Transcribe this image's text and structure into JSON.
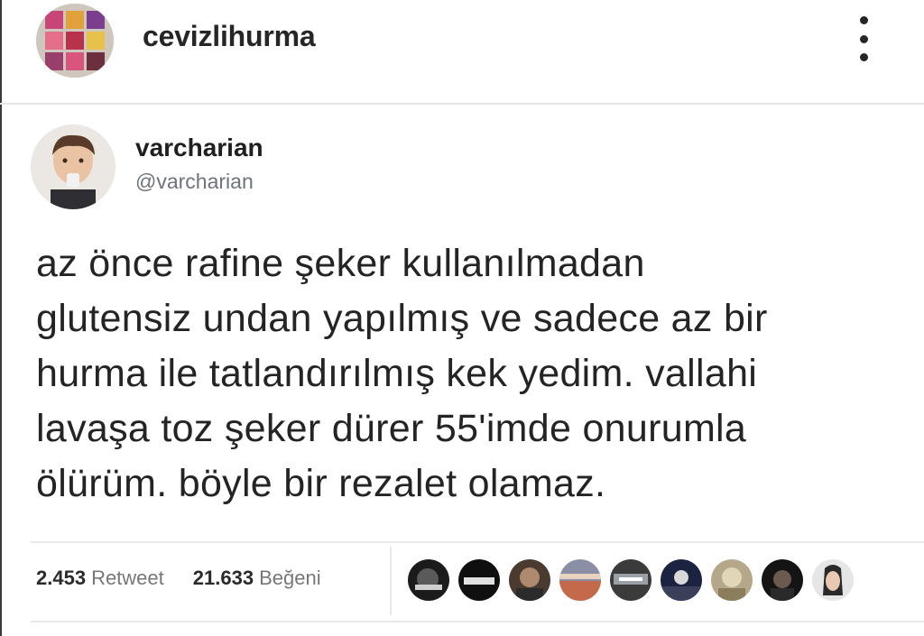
{
  "post": {
    "username": "cevizlihurma",
    "more_icon": "ellipsis-vertical-icon"
  },
  "tweet": {
    "display_name": "varcharian",
    "handle": "@varcharian",
    "text": "az önce rafine şeker kullanılmadan\nglutensiz undan yapılmış ve sadece az bir\nhurma ile tatlandırılmış kek yedim. vallahi\nlavaşa toz şeker dürer 55'imde onurumla\nölürüm. böyle bir rezalet olamaz.",
    "retweet_count": "2.453",
    "retweet_label": "Retweet",
    "like_count": "21.633",
    "like_label": "Beğeni",
    "liker_avatar_count": 9
  },
  "colors": {
    "text": "#262626",
    "muted": "#777777",
    "divider": "#e8e8e8"
  }
}
